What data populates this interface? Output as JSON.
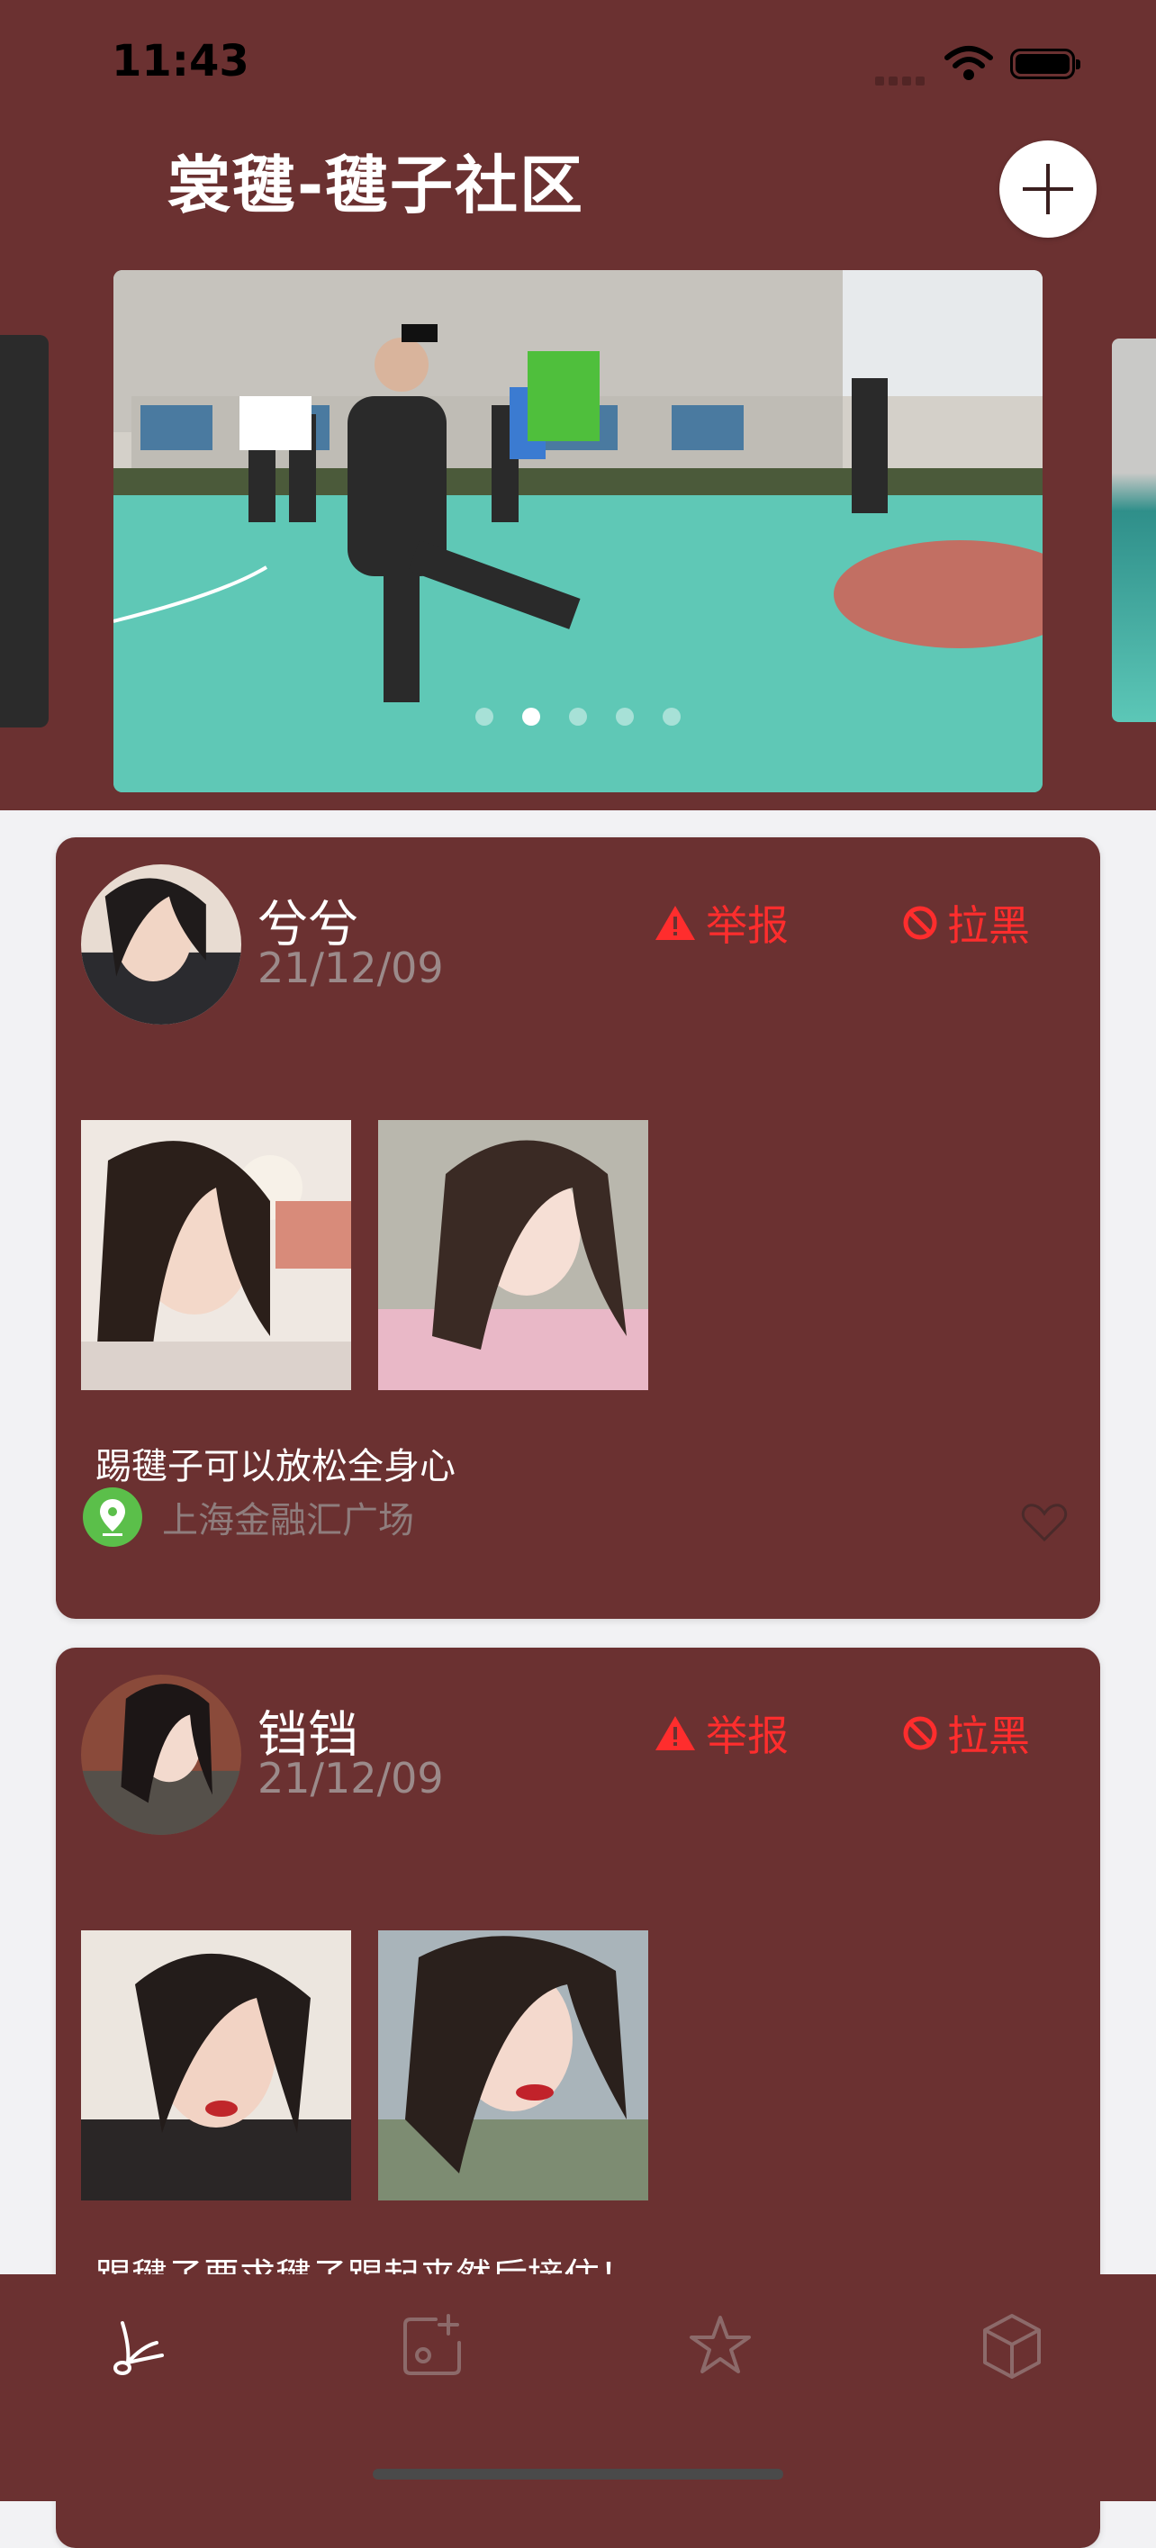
{
  "status_bar": {
    "time": "11:43"
  },
  "header": {
    "title": "裳毽-毽子社区",
    "add_icon": "plus-icon"
  },
  "banner": {
    "page_count": 5,
    "active_page": 2
  },
  "posts": [
    {
      "username": "兮兮",
      "date": "21/12/09",
      "report_label": "举报",
      "block_label": "拉黑",
      "text": "踢毽子可以放松全身心",
      "location": "上海金融汇广场",
      "image_count": 2
    },
    {
      "username": "铛铛",
      "date": "21/12/09",
      "report_label": "举报",
      "block_label": "拉黑",
      "text": "踢毽子要求毽子踢起来然后接住！",
      "image_count": 2
    }
  ],
  "tab_bar": {
    "items": [
      {
        "icon": "shuttlecock-icon",
        "active": true
      },
      {
        "icon": "add-photo-icon",
        "active": false
      },
      {
        "icon": "star-icon",
        "active": false
      },
      {
        "icon": "cube-icon",
        "active": false
      }
    ]
  },
  "colors": {
    "primary": "#6b3131",
    "danger": "#ff2d2d",
    "location": "#5bbf4a"
  }
}
